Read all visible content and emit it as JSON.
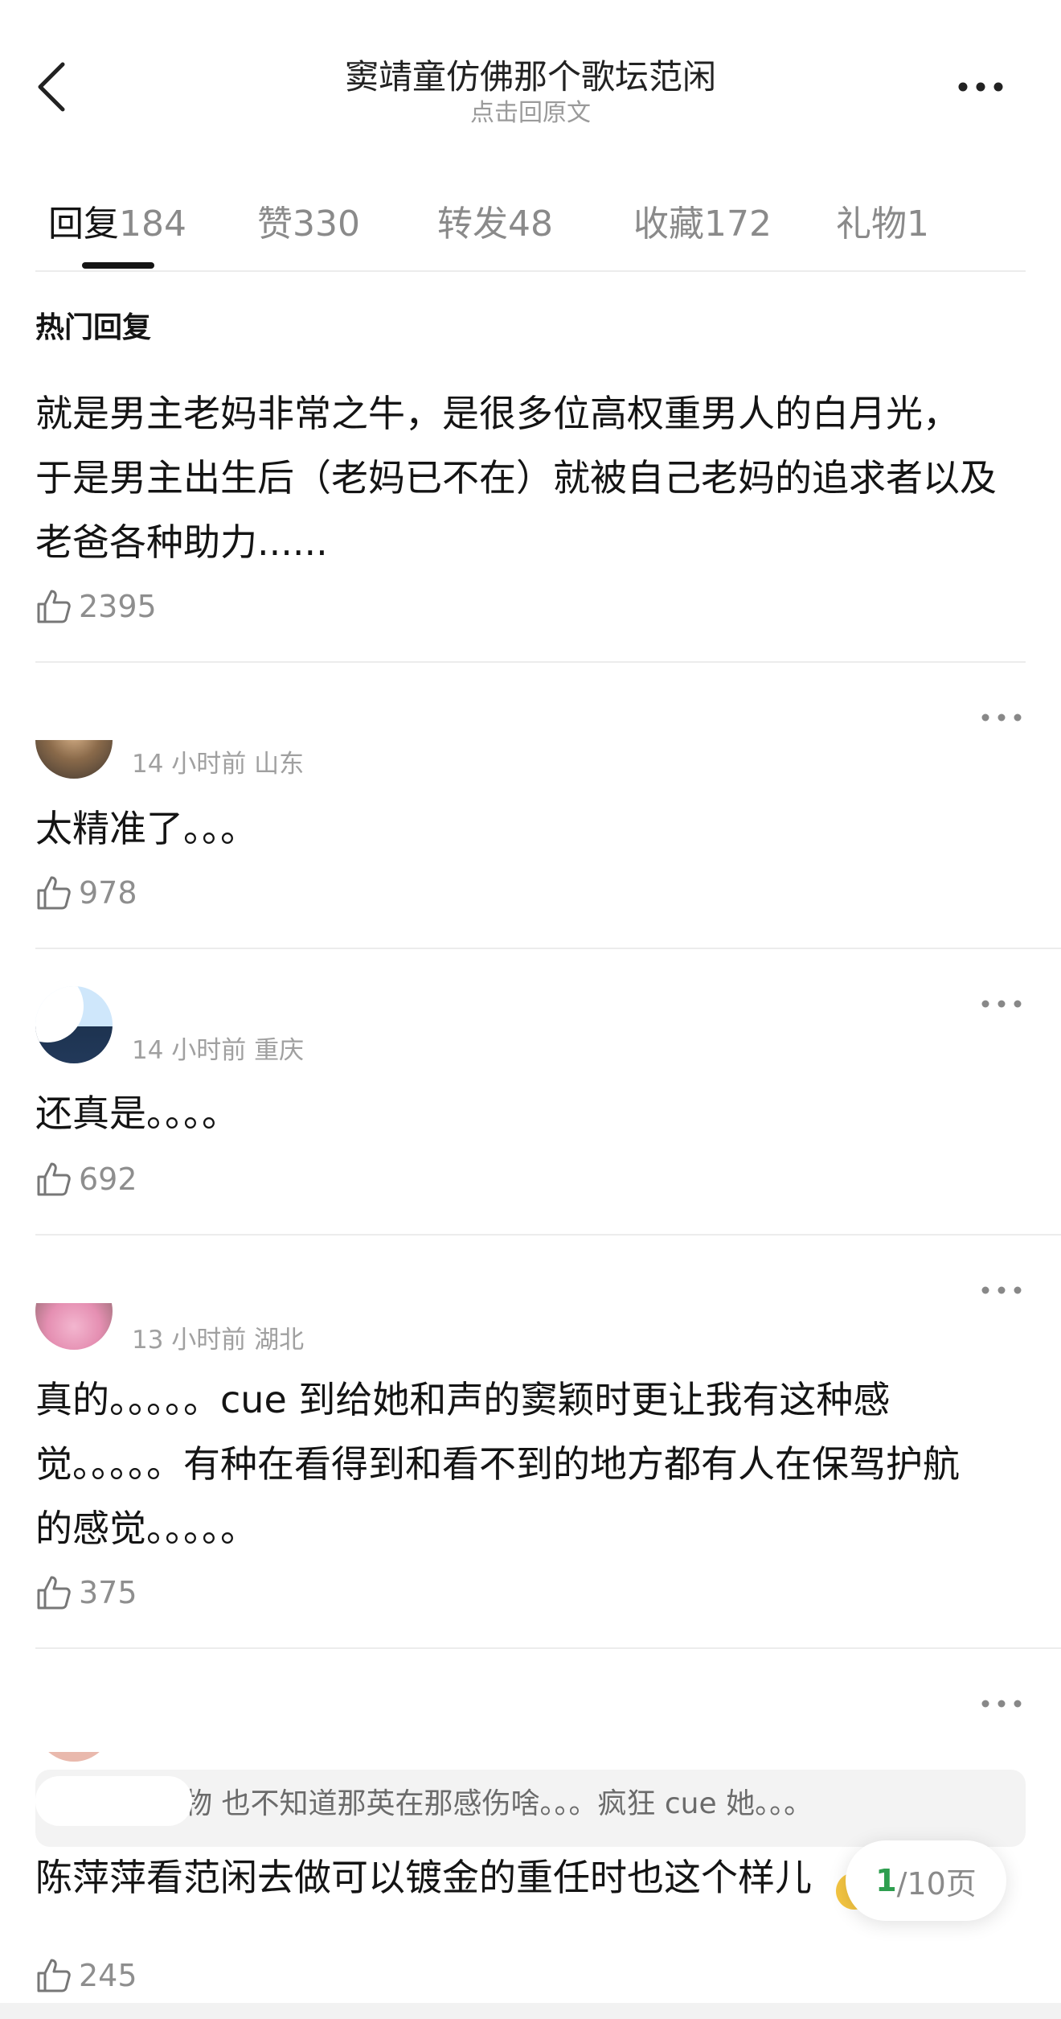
{
  "header": {
    "title": "窦靖童仿佛那个歌坛范闲",
    "subtitle": "点击回原文"
  },
  "tabs": [
    {
      "label": "回复",
      "count": "184"
    },
    {
      "label": "赞",
      "count": "330"
    },
    {
      "label": "转发",
      "count": "48"
    },
    {
      "label": "收藏",
      "count": "172"
    },
    {
      "label": "礼物",
      "count": "1"
    }
  ],
  "hot": {
    "section_title": "热门回复",
    "text_lines": [
      "就是男主老妈非常之牛，是很多位高权重男人的白月光，",
      "于是男主出生后（老妈已不在）就被自己老妈的追求者以及",
      "老爸各种助力......"
    ],
    "likes": "2395"
  },
  "comments": [
    {
      "meta": "14 小时前  山东",
      "text_lines": [
        "太精准了。。。"
      ],
      "likes": "978"
    },
    {
      "meta": "14 小时前  重庆",
      "text_lines": [
        "还真是。。。。"
      ],
      "likes": "692"
    },
    {
      "meta": "13 小时前  湖北",
      "text_lines": [
        "真的。。。。。cue 到给她和声的窦颖时更让我有这种感",
        "觉。。。。。有种在看得到和看不到的地方都有人在保驾护航",
        "的感觉。。。。。"
      ],
      "likes": "375"
    },
    {
      "quote": "物   也不知道那英在那感伤啥。。。疯狂 cue 她。。。",
      "text_lines": [
        "陈萍萍看范闲去做可以镀金的重任时也这个样儿"
      ],
      "likes": "245"
    }
  ],
  "pager": {
    "current": "1",
    "total": "/10页"
  },
  "colors": {
    "accent": "#2e9e4f",
    "muted": "#8e8e8e",
    "divider": "#ececec"
  },
  "icons": [
    "back-chevron-icon",
    "more-icon",
    "thumbs-up-icon"
  ]
}
